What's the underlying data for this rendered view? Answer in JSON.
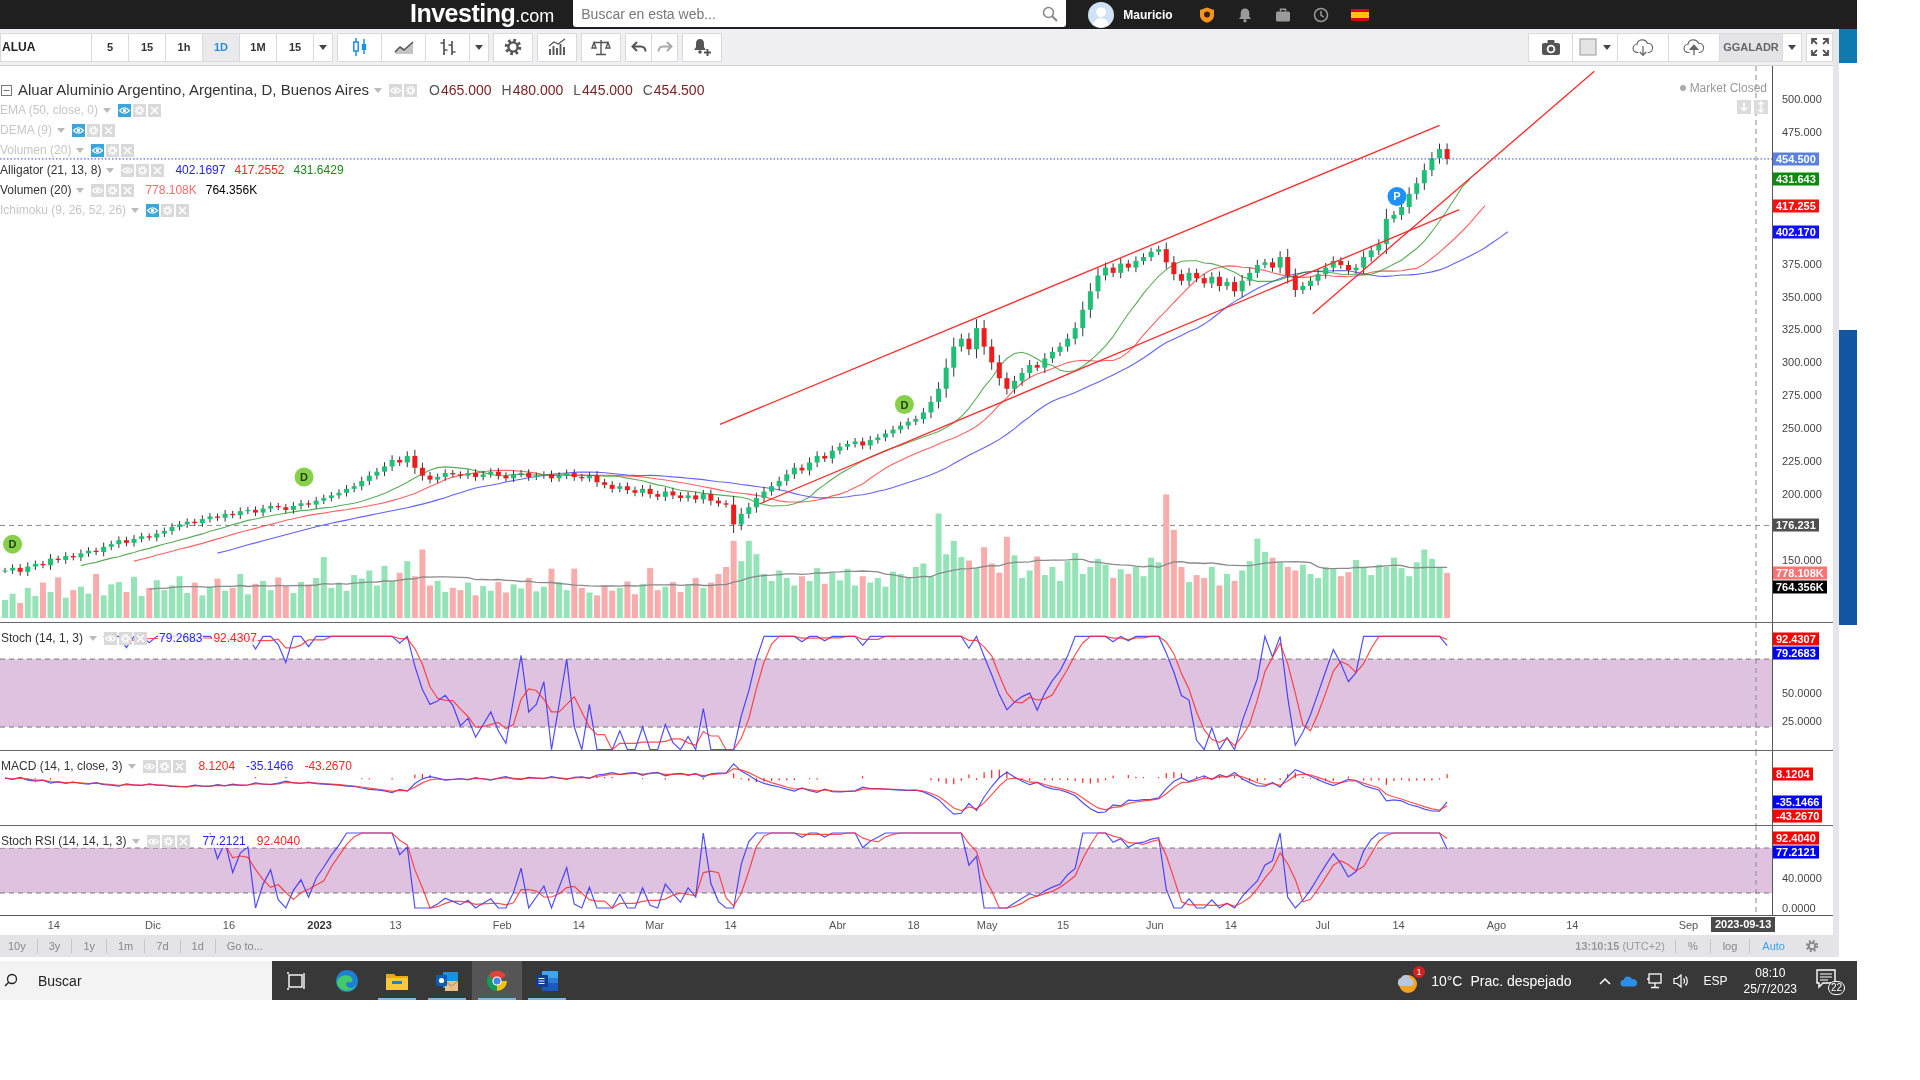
{
  "site": {
    "logo": "Investing",
    "logo_suffix": ".com",
    "search": {
      "placeholder": "Buscar en esta web..."
    },
    "user": "Mauricio"
  },
  "toolbar": {
    "symbol": "ALUA",
    "intervals": [
      {
        "label": "5",
        "selected": false
      },
      {
        "label": "15",
        "selected": false
      },
      {
        "label": "1h",
        "selected": false
      },
      {
        "label": "1D",
        "selected": true
      },
      {
        "label": "1M",
        "selected": false
      },
      {
        "label": "15",
        "selected": false
      }
    ],
    "chart_styles": [
      {
        "kind": "candles",
        "selected": true
      },
      {
        "kind": "line",
        "selected": false
      },
      {
        "kind": "bars",
        "selected": false
      }
    ],
    "compare": "GGALADR"
  },
  "legend": {
    "title": "Aluar Aluminio Argentino, Argentina, D, Buenos Aires",
    "ohlc": [
      {
        "key": "O",
        "value": "465.000"
      },
      {
        "key": "H",
        "value": "480.000"
      },
      {
        "key": "L",
        "value": "445.000"
      },
      {
        "key": "C",
        "value": "454.500"
      }
    ],
    "indicators": [
      {
        "kind": "ema",
        "name": "EMA (50, close, 0)",
        "visible": false
      },
      {
        "kind": "dema",
        "name": "DEMA (9)",
        "visible": false
      },
      {
        "kind": "volume",
        "name": "Volumen (20)",
        "visible": false
      },
      {
        "kind": "alligator",
        "name": "Alligator (21, 13, 8)",
        "visible": true,
        "values": [
          {
            "text": "402.1697",
            "color": "#2020ff"
          },
          {
            "text": "417.2552",
            "color": "#ff2020"
          },
          {
            "text": "431.6429",
            "color": "#138a13"
          }
        ]
      },
      {
        "kind": "volume",
        "name": "Volumen (20)",
        "visible": true,
        "values": [
          {
            "text": "778.108K",
            "color": "#ff6a6a"
          },
          {
            "text": "764.356K",
            "color": "#000000"
          }
        ]
      },
      {
        "kind": "ichimoku",
        "name": "Ichimoku (9, 26, 52, 26)",
        "visible": false
      }
    ]
  },
  "market_status": "Market Closed",
  "price_axis": [
    "500.000",
    "475.000",
    "375.000",
    "350.000",
    "325.000",
    "300.000",
    "275.000",
    "250.000",
    "225.000",
    "200.000",
    "150.000"
  ],
  "date_axis": [
    {
      "label": "14",
      "major": false
    },
    {
      "label": "Dic",
      "major": false
    },
    {
      "label": "16",
      "major": false
    },
    {
      "label": "2023",
      "major": true
    },
    {
      "label": "13",
      "major": false
    },
    {
      "label": "Feb",
      "major": false
    },
    {
      "label": "14",
      "major": false
    },
    {
      "label": "Mar",
      "major": false
    },
    {
      "label": "14",
      "major": false
    },
    {
      "label": "Abr",
      "major": false
    },
    {
      "label": "18",
      "major": false
    },
    {
      "label": "May",
      "major": false
    },
    {
      "label": "15",
      "major": false
    },
    {
      "label": "Jun",
      "major": false
    },
    {
      "label": "14",
      "major": false
    },
    {
      "label": "Jul",
      "major": false
    },
    {
      "label": "14",
      "major": false
    },
    {
      "label": "Ago",
      "major": false
    },
    {
      "label": "14",
      "major": false
    },
    {
      "label": "Sep",
      "major": false
    }
  ],
  "events": [
    {
      "label": "D",
      "color": "#86d04a"
    },
    {
      "label": "D",
      "color": "#86d04a"
    },
    {
      "label": "D",
      "color": "#86d04a"
    },
    {
      "label": "P",
      "color": "#1e90ff"
    }
  ],
  "crosshair": {
    "price": "176.231",
    "date": "2023-09-13"
  },
  "price_axis_tags": [
    {
      "kind": "close",
      "label": "454.500",
      "color": "#5a80e4"
    },
    {
      "kind": "lips",
      "label": "431.643",
      "color": "#0b8a0b"
    },
    {
      "kind": "teeth",
      "label": "417.255",
      "color": "#ff1010"
    },
    {
      "kind": "jaw",
      "label": "402.170",
      "color": "#1010ff"
    },
    {
      "kind": "volume",
      "label": "778.108K",
      "color": "#ff7272"
    },
    {
      "kind": "volume_average",
      "label": "764.356K",
      "color": "#000000"
    }
  ],
  "panes": [
    {
      "kind": "stoch",
      "title": "Stoch (14, 1, 3)",
      "values": [
        {
          "text": "79.2683",
          "color": "#2424ff"
        },
        {
          "text": "92.4307",
          "color": "#ff2424"
        }
      ],
      "ticks": [
        "50.0000",
        "25.0000"
      ],
      "tags": [
        {
          "kind": "d",
          "label": "92.4307",
          "color": "#ff0000"
        },
        {
          "kind": "k",
          "label": "79.2683",
          "color": "#0000ff"
        }
      ]
    },
    {
      "kind": "macd",
      "title": "MACD (14, 1, close, 3)",
      "values": [
        {
          "text": "8.1204",
          "color": "#ff2424"
        },
        {
          "text": "-35.1466",
          "color": "#2424ff"
        },
        {
          "text": "-43.2670",
          "color": "#ff2424"
        }
      ],
      "tags": [
        {
          "kind": "histogram",
          "label": "8.1204",
          "color": "#ff0000"
        },
        {
          "kind": "macd",
          "label": "-35.1466",
          "color": "#0000ff"
        },
        {
          "kind": "signal",
          "label": "-43.2670",
          "color": "#ff0000"
        }
      ]
    },
    {
      "kind": "stochrsi",
      "title": "Stoch RSI (14, 14, 1, 3)",
      "values": [
        {
          "text": "77.2121",
          "color": "#2424ff"
        },
        {
          "text": "92.4040",
          "color": "#ff2424"
        }
      ],
      "ticks": [
        "40.0000",
        "0.0000"
      ],
      "tags": [
        {
          "kind": "d",
          "label": "92.4040",
          "color": "#ff0000"
        },
        {
          "kind": "k",
          "label": "77.2121",
          "color": "#0000ff"
        }
      ]
    }
  ],
  "bottom_bar": {
    "ranges": [
      "10y",
      "3y",
      "1y",
      "1m",
      "7d",
      "1d",
      "Go to..."
    ],
    "clock": "**13:10:15** (UTC+2)",
    "scale_modes": [
      {
        "label": "%",
        "selected": false
      },
      {
        "label": "log",
        "selected": false
      },
      {
        "label": "Auto",
        "selected": true
      }
    ]
  },
  "taskbar": {
    "search": {
      "placeholder": "Buscar"
    },
    "apps": [
      {
        "kind": "taskview",
        "running": false,
        "active": false
      },
      {
        "kind": "edge",
        "running": false,
        "active": false
      },
      {
        "kind": "explorer",
        "running": true,
        "active": false
      },
      {
        "kind": "outlook",
        "running": true,
        "active": false
      },
      {
        "kind": "chrome",
        "running": true,
        "active": true
      },
      {
        "kind": "word",
        "running": true,
        "active": false
      }
    ],
    "weather": {
      "badge": "1",
      "temperature": "10°C",
      "condition": "Prac. despejado"
    },
    "language": "ESP",
    "time": "08:10",
    "date": "25/7/2023",
    "notifications": "22"
  }
}
